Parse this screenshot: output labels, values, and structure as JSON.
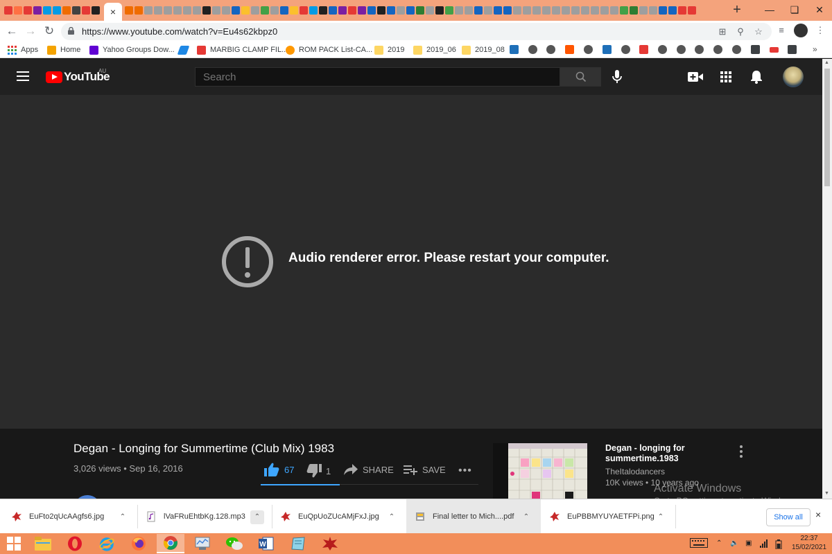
{
  "browser": {
    "tab_favicon_colors": [
      "#e53935",
      "#ff7043",
      "#e53935",
      "#7b1fa2",
      "#039be5",
      "#039be5",
      "#ef6c00",
      "#424242",
      "#e53935",
      "#212121"
    ],
    "tab_favicon_colors_2": [
      "#ef6c00",
      "#ef6c00",
      "#9e9e9e",
      "#9e9e9e",
      "#9e9e9e",
      "#9e9e9e",
      "#9e9e9e",
      "#9e9e9e",
      "#212121",
      "#9e9e9e",
      "#9e9e9e",
      "#1565c0",
      "#fbc02d",
      "#9e9e9e",
      "#43a047",
      "#9e9e9e",
      "#1565c0",
      "#fbc02d",
      "#e53935",
      "#039be5",
      "#212121",
      "#1565c0",
      "#7b1fa2",
      "#e53935",
      "#7b1fa2",
      "#1565c0",
      "#212121",
      "#1565c0",
      "#9e9e9e",
      "#1565c0",
      "#2e7d32",
      "#9e9e9e",
      "#212121",
      "#43a047",
      "#9e9e9e",
      "#9e9e9e",
      "#1565c0",
      "#9e9e9e",
      "#1565c0",
      "#1565c0",
      "#9e9e9e",
      "#9e9e9e",
      "#9e9e9e",
      "#9e9e9e",
      "#9e9e9e",
      "#9e9e9e",
      "#9e9e9e",
      "#9e9e9e",
      "#9e9e9e",
      "#9e9e9e",
      "#9e9e9e",
      "#43a047",
      "#2e7d32",
      "#9e9e9e",
      "#9e9e9e",
      "#1565c0",
      "#1565c0",
      "#e53935",
      "#e53935"
    ],
    "active_tab_close": "×",
    "new_tab": "+",
    "url": "https://www.youtube.com/watch?v=Eu4s62kbpz0",
    "bookmarks": [
      {
        "label": "Apps",
        "color": "#e53935"
      },
      {
        "label": "Home",
        "color": "#f4a300"
      },
      {
        "label": "Yahoo Groups Dow...",
        "color": "#6001d2"
      },
      {
        "label": "",
        "color": "#1e88e5"
      },
      {
        "label": "MARBIG CLAMP FIL...",
        "color": "#e53935"
      },
      {
        "label": "ROM PACK List-CA...",
        "color": "#ff9800"
      },
      {
        "label": "2019",
        "color": "#fdd663"
      },
      {
        "label": "2019_06",
        "color": "#fdd663"
      },
      {
        "label": "2019_08",
        "color": "#fdd663"
      }
    ]
  },
  "youtube": {
    "logo_text": "YouTube",
    "region": "AU",
    "search_placeholder": "Search",
    "error_message": "Audio renderer error. Please restart your computer.",
    "video": {
      "title": "Degan - Longing for Summertime (Club Mix) 1983",
      "meta": "3,026 views • Sep 16, 2016",
      "likes": "67",
      "dislikes": "1",
      "share_label": "SHARE",
      "save_label": "SAVE"
    },
    "recommended": {
      "title": "Degan - longing for summertime.1983",
      "channel": "TheItalodancers",
      "meta": "10K views • 10 years ago"
    },
    "watermark_title": "Activate Windows",
    "watermark_sub": "Go to PC settings to activate Windows."
  },
  "downloads": {
    "items": [
      {
        "name": "EuFto2qUcAAgfs6.jpg"
      },
      {
        "name": "lVaFRuEhtbKg.128.mp3"
      },
      {
        "name": "EuQpUoZUcAMjFxJ.jpg"
      },
      {
        "name": "Final letter to Mich....pdf"
      },
      {
        "name": "EuPBBMYUYAETFPi.png"
      }
    ],
    "show_all": "Show all",
    "close": "×"
  },
  "taskbar": {
    "time": "22:37",
    "date": "15/02/2021"
  }
}
